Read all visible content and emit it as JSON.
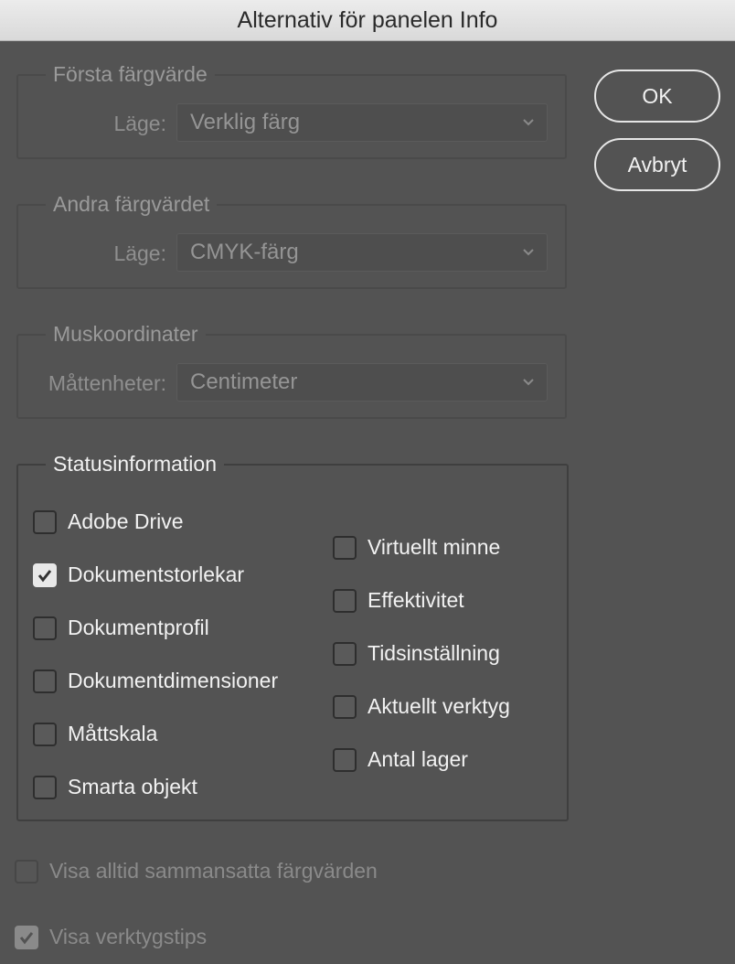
{
  "window": {
    "title": "Alternativ för panelen Info"
  },
  "first_color": {
    "legend": "Första färgvärde",
    "mode_label": "Läge:",
    "mode_value": "Verklig färg"
  },
  "second_color": {
    "legend": "Andra färgvärdet",
    "mode_label": "Läge:",
    "mode_value": "CMYK-färg"
  },
  "mouse_coords": {
    "legend": "Muskoordinater",
    "units_label": "Måttenheter:",
    "units_value": "Centimeter"
  },
  "status": {
    "legend": "Statusinformation",
    "left_items": [
      {
        "label": "Adobe Drive",
        "checked": false
      },
      {
        "label": "Dokumentstorlekar",
        "checked": true
      },
      {
        "label": "Dokumentprofil",
        "checked": false
      },
      {
        "label": "Dokumentdimensioner",
        "checked": false
      },
      {
        "label": "Måttskala",
        "checked": false
      },
      {
        "label": "Smarta objekt",
        "checked": false
      }
    ],
    "right_items": [
      {
        "label": "Virtuellt minne",
        "checked": false
      },
      {
        "label": "Effektivitet",
        "checked": false
      },
      {
        "label": "Tidsinställning",
        "checked": false
      },
      {
        "label": "Aktuellt verktyg",
        "checked": false
      },
      {
        "label": "Antal lager",
        "checked": false
      }
    ]
  },
  "options": {
    "composite_label": "Visa alltid sammansatta färgvärden",
    "composite_checked": false,
    "tooltips_label": "Visa verktygstips",
    "tooltips_checked": true
  },
  "buttons": {
    "ok": "OK",
    "cancel": "Avbryt"
  },
  "icons": {
    "chevron": "chevron-down-icon",
    "check": "checkmark-icon"
  }
}
